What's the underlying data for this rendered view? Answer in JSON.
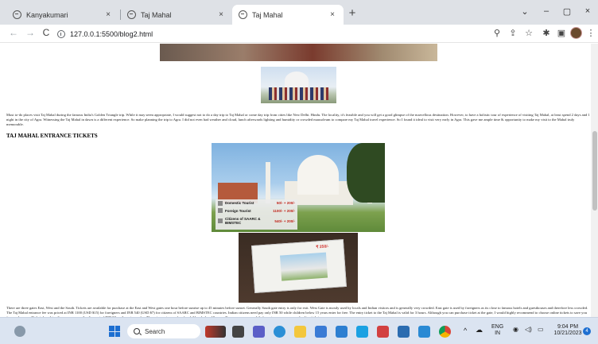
{
  "browser": {
    "tabs": [
      {
        "title": "Kanyakumari",
        "active": false
      },
      {
        "title": "Taj Mahal",
        "active": false
      },
      {
        "title": "Taj Mahal",
        "active": true
      }
    ],
    "close_glyph": "×",
    "new_tab_glyph": "+",
    "window_controls": {
      "dropdown": "⌄",
      "minimize": "–",
      "maximize": "▢",
      "close": "×"
    },
    "nav": {
      "back": "←",
      "forward": "→",
      "reload": "C"
    },
    "url": "127.0.0.1:5500/blog2.html",
    "toolbar_icons": [
      "zoom-icon",
      "share-icon",
      "star-icon",
      "extensions-icon",
      "sidebar-icon",
      "profile-avatar",
      "menu-icon"
    ]
  },
  "page": {
    "intro_paragraph": "Must to-do places visit Taj Mahal during the famous India's Golden Triangle trip. While it may seem appropriate, I would suggest not to do a day trip to Taj Mahal or come day trip from cities like New Delhi. Hindu. The locality, it's feasible and you will get a good glimpse of the marvellous destination. However, to have a holistic tour of experience of visiting Taj Mahal, at least spend 2 days and 1 night in the city of Agra. Witnessing the Taj Mahal in dawn is a different experience. So make planning the trip to Agra. I did not even had weather and cloud, lunch afterwards lighting and humidity or crowded mausoleum to compare my Taj Mahal travel experience. So I found it ideal to visit very early in Agra. This gave me ample time & opportunity to make my visit to the Mahal truly memorable.",
    "section_heading": "TAJ MAHAL ENTRANCE TICKETS",
    "ticket_prices": [
      {
        "label": "Domestic Tourist",
        "value": "50/- + 200/-"
      },
      {
        "label": "Foreign Tourist",
        "value": "1100/- + 200/-"
      },
      {
        "label": "Citizens of SAARC & BIMSTEC",
        "value": "540/- + 200/-"
      }
    ],
    "ticket_photo_price": "₹ 250/-",
    "bottom_paragraph": "There are three gates East, West and the South. Tickets are available for purchase at the East and West gates one hour before sunrise up to 45 minutes before sunset. Generally South gate entry is only for exit. West Gate is mostly used by locals and Indian visitors and is generally very crowded. East gate is used by foreigners as its close to famous hotels and guesthouses and therefore less crowded. The Taj Mahal entrance fee was priced at INR 1100 (USD $15) for foreigners and INR 540 (USD $7) for citizens of SAARC and BIMSTEC countries. Indian citizens need pay only INR 50 while children below 15 years enter for free. The entry ticket to the Taj Mahal is valid for 3 hours. Although you can purchase ticket at the gate, I would highly recommend to choose online tickets to save you time and money. Tickets bought online, you can avail a discount of INR 50 on the entrance fee. The entrance is now free for children below 15 years. You can use your mobile for entrance purposes and online tickets."
  },
  "taskbar": {
    "search_placeholder": "Search",
    "language": "ENG",
    "region": "IN",
    "time": "9:04 PM",
    "date": "10/21/2023",
    "notification_count": "4",
    "tray_up": "^"
  }
}
